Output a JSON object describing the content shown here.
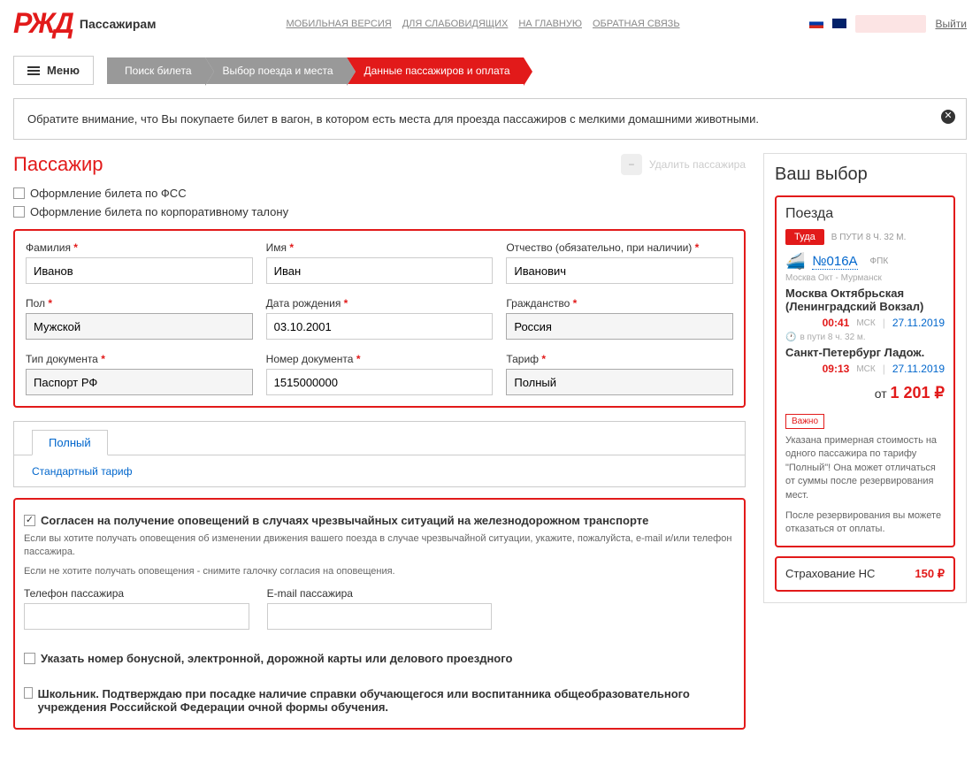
{
  "header": {
    "logo": "РЖД",
    "sub": "Пассажирам",
    "links": [
      "МОБИЛЬНАЯ ВЕРСИЯ",
      "ДЛЯ СЛАБОВИДЯЩИХ",
      "НА ГЛАВНУЮ",
      "ОБРАТНАЯ СВЯЗЬ"
    ],
    "exit": "Выйти",
    "menu": "Меню"
  },
  "breadcrumb": [
    "Поиск билета",
    "Выбор поезда и места",
    "Данные пассажиров и оплата"
  ],
  "notice": "Обратите внимание, что Вы покупаете билет в вагон, в котором есть места для проезда пассажиров с мелкими домашними животными.",
  "passenger": {
    "title": "Пассажир",
    "delete": "Удалить пассажира",
    "fss": "Оформление билета по ФСС",
    "corp": "Оформление билета по корпоративному талону"
  },
  "form": {
    "lastname_label": "Фамилия",
    "lastname": "Иванов",
    "firstname_label": "Имя",
    "firstname": "Иван",
    "patronymic_label": "Отчество (обязательно, при наличии)",
    "patronymic": "Иванович",
    "gender_label": "Пол",
    "gender": "Мужской",
    "dob_label": "Дата рождения",
    "dob": "03.10.2001",
    "citizenship_label": "Гражданство",
    "citizenship": "Россия",
    "doctype_label": "Тип документа",
    "doctype": "Паспорт РФ",
    "docnum_label": "Номер документа",
    "docnum": "1515000000",
    "tariff_label": "Тариф",
    "tariff": "Полный"
  },
  "tariff_box": {
    "tab": "Полный",
    "link": "Стандартный тариф"
  },
  "consent": {
    "label": "Согласен на получение оповещений в случаях чрезвычайных ситуаций на железнодорожном транспорте",
    "info1": "Если вы хотите получать оповещения об изменении движения вашего поезда в случае чрезвычайной ситуации, укажите, пожалуйста, e-mail и/или телефон пассажира.",
    "info2": "Если не хотите получать оповещения - снимите галочку согласия на оповещения.",
    "phone_label": "Телефон пассажира",
    "email_label": "E-mail пассажира"
  },
  "bonus_chk": "Указать номер бонусной, электронной, дорожной карты или делового проездного",
  "school_chk": "Школьник. Подтверждаю при посадке наличие справки обучающегося или воспитанника общеобразовательного учреждения Российской Федерации очной формы обучения.",
  "sidebar": {
    "title": "Ваш выбор",
    "trains_head": "Поезда",
    "tuda": "Туда",
    "travel_time": "В ПУТИ 8 Ч. 32 М.",
    "train_num": "№016А",
    "company": "ФПК",
    "route": "Москва Окт - Мурманск",
    "station_from": "Москва Октябрьская (Ленинградский Вокзал)",
    "time_from": "00:41",
    "msk": "МСК",
    "date_from": "27.11.2019",
    "transit": "в пути  8 ч. 32 м.",
    "station_to": "Санкт-Петербург Ладож.",
    "time_to": "09:13",
    "date_to": "27.11.2019",
    "price_from": "от",
    "price": "1 201 ₽",
    "important": "Важно",
    "important_text1": "Указана примерная стоимость на одного пассажира по тарифу \"Полный\"! Она может отличаться от суммы после резервирования мест.",
    "important_text2": "После резервирования вы можете отказаться от оплаты.",
    "insurance_label": "Страхование НС",
    "insurance_price": "150 ₽"
  }
}
